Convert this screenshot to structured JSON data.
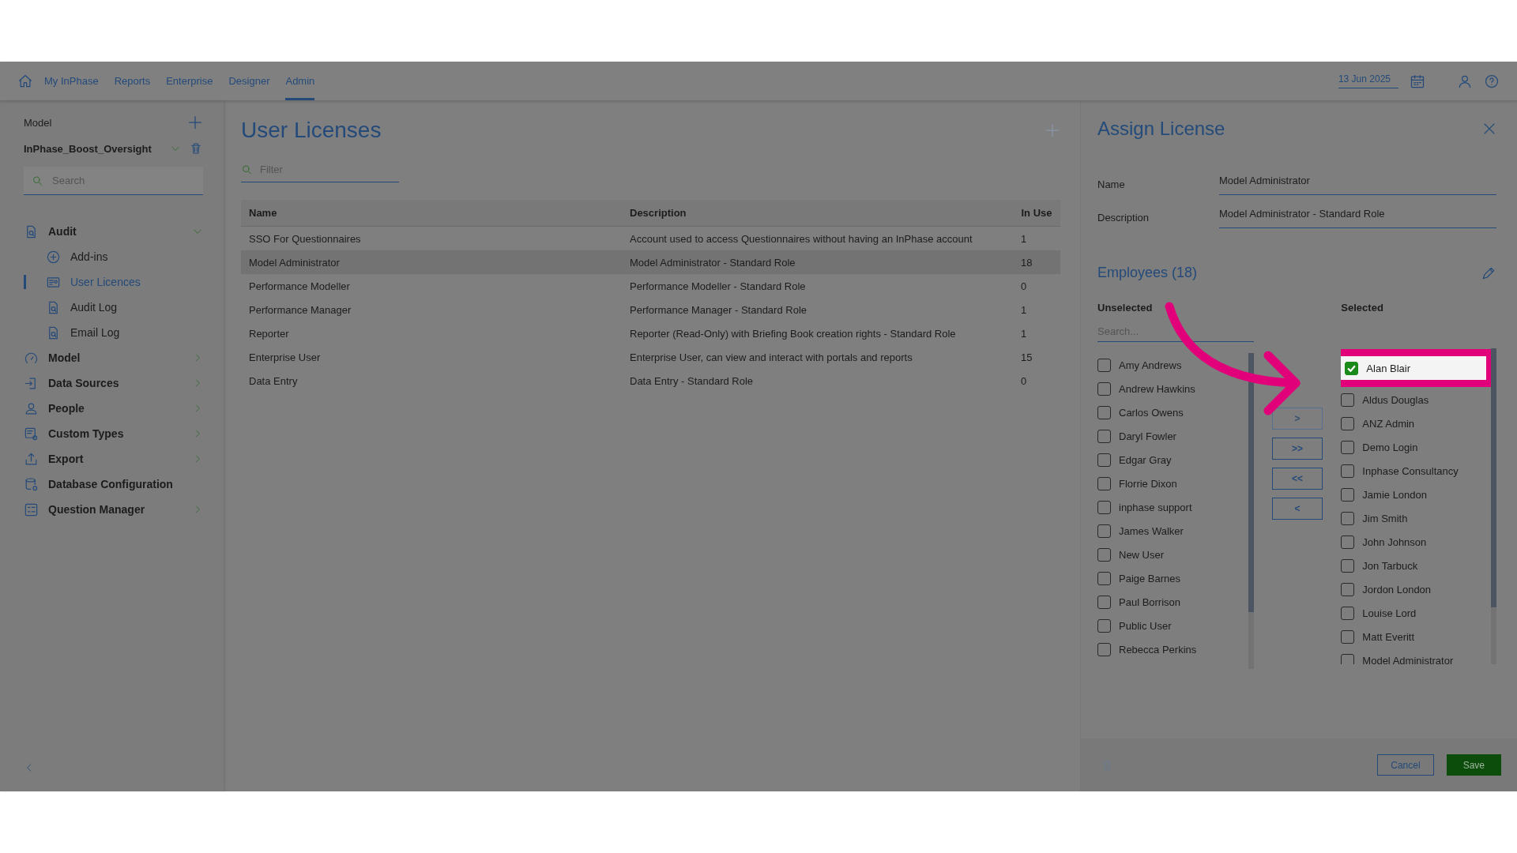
{
  "nav": {
    "tabs": [
      {
        "label": "My InPhase",
        "selected": false
      },
      {
        "label": "Reports",
        "selected": false
      },
      {
        "label": "Enterprise",
        "selected": false
      },
      {
        "label": "Designer",
        "selected": false
      },
      {
        "label": "Admin",
        "selected": true
      }
    ],
    "date": "13 Jun 2025"
  },
  "sidebar": {
    "model_label": "Model",
    "model_name": "InPhase_Boost_Oversight",
    "search": {
      "placeholder": "Search"
    },
    "items": [
      {
        "label": "Audit",
        "expanded": true,
        "children": [
          {
            "label": "Add-ins",
            "selected": false
          },
          {
            "label": "User Licences",
            "selected": true
          },
          {
            "label": "Audit Log",
            "selected": false
          },
          {
            "label": "Email Log",
            "selected": false
          }
        ]
      },
      {
        "label": "Model",
        "expanded": false
      },
      {
        "label": "Data Sources",
        "expanded": false
      },
      {
        "label": "People",
        "expanded": false
      },
      {
        "label": "Custom Types",
        "expanded": false
      },
      {
        "label": "Export",
        "expanded": false
      },
      {
        "label": "Database Configuration"
      },
      {
        "label": "Question Manager",
        "expanded": false
      }
    ]
  },
  "main": {
    "title": "User Licenses",
    "filter": {
      "placeholder": "Filter"
    },
    "table": {
      "columns": [
        "Name",
        "Description",
        "In Use"
      ],
      "rows": [
        {
          "cells": [
            "SSO For Questionnaires",
            "Account used to access Questionnaires without having an InPhase account",
            "1"
          ],
          "selected": false
        },
        {
          "cells": [
            "Model Administrator",
            "Model Administrator - Standard Role",
            "18"
          ],
          "selected": true
        },
        {
          "cells": [
            "Performance Modeller",
            "Performance Modeller - Standard Role",
            "0"
          ],
          "selected": false
        },
        {
          "cells": [
            "Performance Manager",
            "Performance Manager - Standard Role",
            "1"
          ],
          "selected": false
        },
        {
          "cells": [
            "Reporter",
            "Reporter (Read-Only) with Briefing Book creation rights - Standard Role",
            "1"
          ],
          "selected": false
        },
        {
          "cells": [
            "Enterprise User",
            "Enterprise User, can view and interact with portals and reports",
            "15"
          ],
          "selected": false
        },
        {
          "cells": [
            "Data Entry",
            "Data Entry - Standard Role",
            "0"
          ],
          "selected": false
        }
      ]
    }
  },
  "panel": {
    "title": "Assign License",
    "fields": [
      {
        "label": "Name",
        "value": "Model Administrator"
      },
      {
        "label": "Description",
        "value": "Model Administrator - Standard Role"
      }
    ],
    "employees_title": "Employees (18)",
    "unselected_label": "Unselected",
    "selected_label": "Selected",
    "search": {
      "placeholder": "Search..."
    },
    "unselected": [
      {
        "name": "Amy Andrews",
        "checked": false
      },
      {
        "name": "Andrew Hawkins",
        "checked": false
      },
      {
        "name": "Carlos Owens",
        "checked": false
      },
      {
        "name": "Daryl Fowler",
        "checked": false
      },
      {
        "name": "Edgar Gray",
        "checked": false
      },
      {
        "name": "Florrie Dixon",
        "checked": false
      },
      {
        "name": "inphase support",
        "checked": false
      },
      {
        "name": "James Walker",
        "checked": false
      },
      {
        "name": "New User",
        "checked": false
      },
      {
        "name": "Paige Barnes",
        "checked": false
      },
      {
        "name": "Paul Borrison",
        "checked": false
      },
      {
        "name": "Public User",
        "checked": false
      },
      {
        "name": "Rebecca Perkins",
        "checked": false
      }
    ],
    "transfer_buttons": [
      {
        "label": ">",
        "disabled": true
      },
      {
        "label": ">>",
        "disabled": false
      },
      {
        "label": "<<",
        "disabled": false
      },
      {
        "label": "<",
        "disabled": false
      }
    ],
    "selected": [
      {
        "name": "Alan Blair",
        "checked": true,
        "highlighted": true
      },
      {
        "name": "Aldus Douglas",
        "checked": false,
        "highlighted": false
      },
      {
        "name": "ANZ Admin",
        "checked": false,
        "highlighted": false
      },
      {
        "name": "Demo Login",
        "checked": false,
        "highlighted": false
      },
      {
        "name": "Inphase Consultancy",
        "checked": false,
        "highlighted": false
      },
      {
        "name": "Jamie London",
        "checked": false,
        "highlighted": false
      },
      {
        "name": "Jim Smith",
        "checked": false,
        "highlighted": false
      },
      {
        "name": "John Johnson",
        "checked": false,
        "highlighted": false
      },
      {
        "name": "Jon Tarbuck",
        "checked": false,
        "highlighted": false
      },
      {
        "name": "Jordon London",
        "checked": false,
        "highlighted": false
      },
      {
        "name": "Louise Lord",
        "checked": false,
        "highlighted": false
      },
      {
        "name": "Matt Everitt",
        "checked": false,
        "highlighted": false
      },
      {
        "name": "Model Administrator",
        "checked": false,
        "highlighted": false
      }
    ],
    "buttons": {
      "cancel": "Cancel",
      "save": "Save"
    }
  }
}
